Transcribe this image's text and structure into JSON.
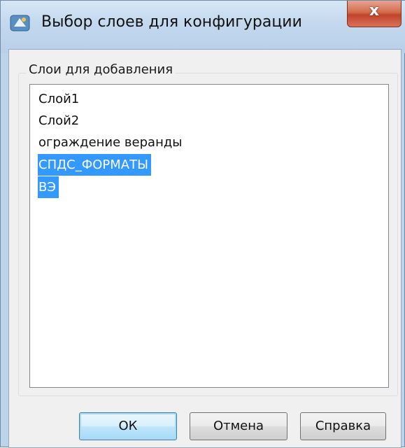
{
  "window": {
    "title": "Выбор слоев для конфигурации",
    "close_glyph": "x",
    "app_icon": "autocad-app-icon"
  },
  "group": {
    "label": "Слои для добавления"
  },
  "layers": [
    {
      "label": "Слой1",
      "selected": false
    },
    {
      "label": "Слой2",
      "selected": false
    },
    {
      "label": "ограждение веранды",
      "selected": false
    },
    {
      "label": "СПДС_ФОРМАТЫ",
      "selected": true
    },
    {
      "label": "ВЭ",
      "selected": true
    }
  ],
  "buttons": {
    "ok_label": "ОК",
    "cancel_label": "Отмена",
    "help_label": "Справка"
  },
  "colors": {
    "selection": "#3399ff",
    "titlebar": "#c3d8ee",
    "close_button": "#c2432a"
  }
}
